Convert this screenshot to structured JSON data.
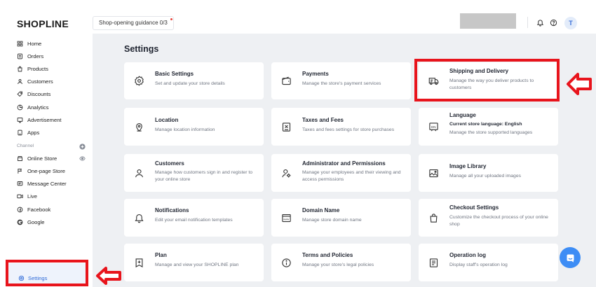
{
  "header": {
    "logo": "SHOPLINE",
    "guidance": "Shop-opening guidance 0/3",
    "avatar_letter": "T"
  },
  "sidebar": {
    "items": [
      {
        "label": "Home",
        "icon": "home-icon"
      },
      {
        "label": "Orders",
        "icon": "orders-icon"
      },
      {
        "label": "Products",
        "icon": "bag-icon"
      },
      {
        "label": "Customers",
        "icon": "user-icon"
      },
      {
        "label": "Discounts",
        "icon": "tag-icon"
      },
      {
        "label": "Analytics",
        "icon": "chart-icon"
      },
      {
        "label": "Advertisement",
        "icon": "megaphone-icon"
      },
      {
        "label": "Apps",
        "icon": "apps-icon"
      }
    ],
    "channel_label": "Channel",
    "channels": [
      {
        "label": "Online Store",
        "icon": "store-icon"
      },
      {
        "label": "One-page Store",
        "icon": "flag-icon"
      },
      {
        "label": "Message Center",
        "icon": "message-icon"
      },
      {
        "label": "Live",
        "icon": "live-icon"
      },
      {
        "label": "Facebook",
        "icon": "facebook-icon"
      },
      {
        "label": "Google",
        "icon": "google-icon"
      }
    ],
    "settings_label": "Settings"
  },
  "main": {
    "title": "Settings",
    "cards": [
      {
        "title": "Basic Settings",
        "desc": "Set and update your store details",
        "icon": "gear-icon"
      },
      {
        "title": "Payments",
        "desc": "Manage the store's payment services",
        "icon": "wallet-icon"
      },
      {
        "title": "Shipping and Delivery",
        "desc": "Manage the way you deliver products to customers",
        "icon": "truck-icon"
      },
      {
        "title": "Location",
        "desc": "Manage location information",
        "icon": "location-icon"
      },
      {
        "title": "Taxes and Fees",
        "desc": "Taxes and fees settings for store purchases",
        "icon": "receipt-icon"
      },
      {
        "title": "Language",
        "sub": "Current store language: English",
        "desc": "Manage the store supported languages",
        "icon": "language-icon"
      },
      {
        "title": "Customers",
        "desc": "Manage how customers sign in and register to your online store",
        "icon": "customer-icon"
      },
      {
        "title": "Administrator and Permissions",
        "desc": "Manage your employees and their viewing and access permissions",
        "icon": "admin-icon"
      },
      {
        "title": "Image Library",
        "desc": "Manage all your uploaded images",
        "icon": "image-icon"
      },
      {
        "title": "Notifications",
        "desc": "Edit your email notification templates",
        "icon": "bell-icon"
      },
      {
        "title": "Domain Name",
        "desc": "Manage store domain name",
        "icon": "domain-icon"
      },
      {
        "title": "Checkout Settings",
        "desc": "Customize the checkout process of your online shop",
        "icon": "checkout-icon"
      },
      {
        "title": "Plan",
        "desc": "Manage and view your SHOPLINE plan",
        "icon": "plan-icon"
      },
      {
        "title": "Terms and Policies",
        "desc": "Manage your store's legal policies",
        "icon": "info-icon"
      },
      {
        "title": "Operation log",
        "desc": "Display staff's operation log",
        "icon": "log-icon"
      }
    ]
  },
  "colors": {
    "accent": "#2f6bd8",
    "highlight": "#e8141c",
    "chat": "#3d8df5",
    "main_bg": "#eef0f3"
  }
}
